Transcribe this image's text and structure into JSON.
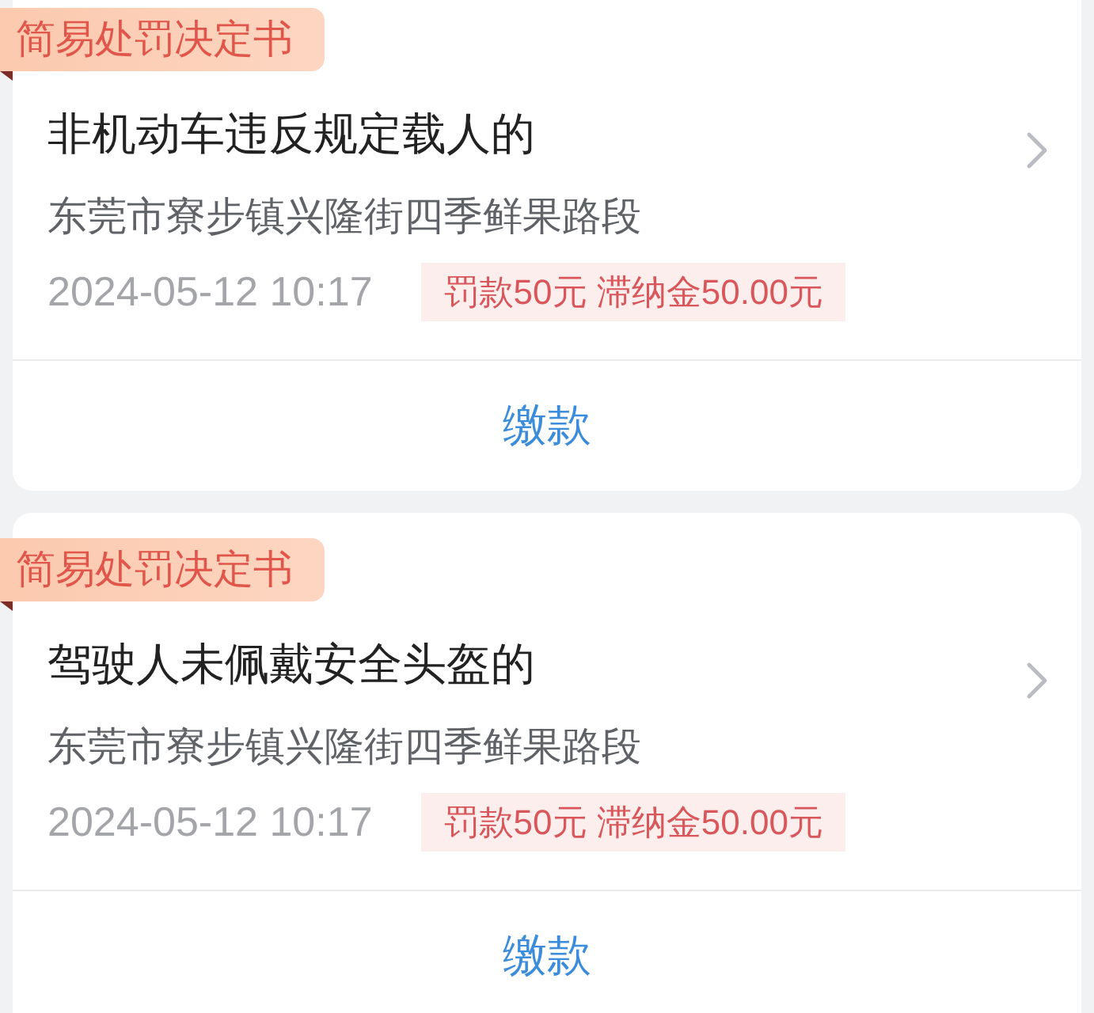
{
  "notices": [
    {
      "badge": "简易处罚决定书",
      "title": "非机动车违反规定载人的",
      "location": "东莞市寮步镇兴隆街四季鲜果路段",
      "time": "2024-05-12 10:17",
      "amount": "罚款50元 滞纳金50.00元",
      "action": "缴款"
    },
    {
      "badge": "简易处罚决定书",
      "title": "驾驶人未佩戴安全头盔的",
      "location": "东莞市寮步镇兴隆街四季鲜果路段",
      "time": "2024-05-12 10:17",
      "amount": "罚款50元 滞纳金50.00元",
      "action": "缴款"
    }
  ]
}
